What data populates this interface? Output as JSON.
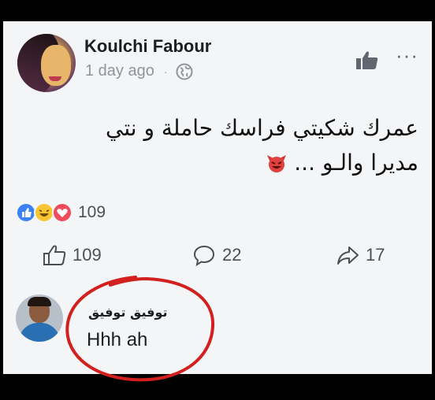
{
  "post": {
    "author": "Koulchi Fabour",
    "time": "1 day ago",
    "separator": "·",
    "more_label": "···",
    "text_line1": "عمرك شكيتي فراسك حاملة و نتي",
    "text_line2": "مديرا والـو ...",
    "emoji": "devil-emoji"
  },
  "reactions": {
    "types": [
      "like",
      "haha",
      "love"
    ],
    "count": "109"
  },
  "actions": {
    "like_count": "109",
    "comment_count": "22",
    "share_count": "17"
  },
  "comment": {
    "author": "توفيق توفيق",
    "text": "Hhh ah"
  },
  "colors": {
    "background": "#000000",
    "card": "#f4f5f7",
    "annotation_circle": "#d2201f",
    "like_blue": "#3b82f6",
    "love_red": "#f04b5c",
    "haha_yellow": "#f7c531"
  }
}
